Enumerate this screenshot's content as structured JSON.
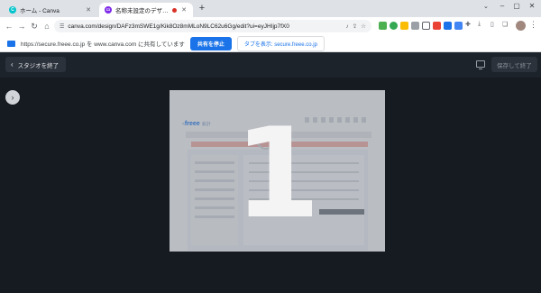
{
  "browser": {
    "tabs": [
      {
        "title": "ホーム - Canva",
        "active": false,
        "favicon_color": "#00c4cc"
      },
      {
        "title": "名称未設定のデザイン - プレゼ",
        "active": true,
        "favicon_color": "#7d2ae8"
      }
    ],
    "new_tab_symbol": "+",
    "url": "canva.com/design/DAFz3mSWE1g/Kik8Oz8mMLoN9LC62u6Gg/edit?ui=eyJHIjp7fX0",
    "icons": [
      "back-icon",
      "forward-icon",
      "reload-icon",
      "tune-icon",
      "mic-icon",
      "share-icon",
      "star-icon",
      "extensions-icon",
      "download-icon",
      "sidepanel-icon",
      "profile-icon",
      "menu-icon"
    ]
  },
  "sharebar": {
    "message": "https://secure.freee.co.jp を www.canva.com に共有しています",
    "stop_label": "共有を停止",
    "switch_label": "タブを表示: secure.freee.co.jp"
  },
  "app": {
    "exit_label": "スタジオを終了",
    "save_exit_label": "保存して終了",
    "countdown": "1"
  },
  "slide_preview": {
    "logo_text": "freee",
    "logo_sub": "会計"
  },
  "colors": {
    "accent": "#1a73e8",
    "app_bg": "#161b22",
    "tabstrip_bg": "#dee1e6"
  }
}
